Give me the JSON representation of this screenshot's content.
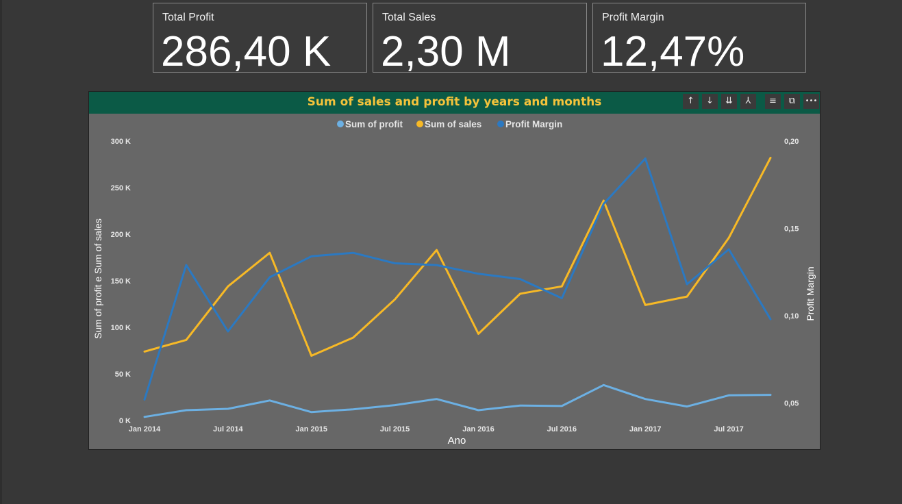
{
  "cards": [
    {
      "title": "Total Profit",
      "value": "286,40 K"
    },
    {
      "title": "Total Sales",
      "value": "2,30 M"
    },
    {
      "title": "Profit Margin",
      "value": "12,47%"
    }
  ],
  "toolbar_icons": [
    "arrow-up-icon",
    "arrow-down-icon",
    "double-arrow-down-icon",
    "expand-hierarchy-icon",
    "filter-icon",
    "focus-mode-icon",
    "more-options-icon"
  ],
  "toolbar_glyphs": {
    "up": "↑",
    "down": "↓",
    "down_all": "⇊",
    "expand": "⅄",
    "filter": "≡",
    "focus": "⧉",
    "more": "•••"
  },
  "chart_data": {
    "type": "line",
    "title": "Sum of sales and profit by years and months",
    "xlabel": "Ano",
    "ylabel": "Sum of profit e Sum of sales",
    "y2label": "Profit Margin",
    "x": [
      "Jan 2014",
      "Apr 2014",
      "Jul 2014",
      "Oct 2014",
      "Jan 2015",
      "Apr 2015",
      "Jul 2015",
      "Oct 2015",
      "Jan 2016",
      "Apr 2016",
      "Jul 2016",
      "Oct 2016",
      "Jan 2017",
      "Apr 2017",
      "Jul 2017",
      "Oct 2017"
    ],
    "x_tick_labels": [
      "Jan 2014",
      "Jul 2014",
      "Jan 2015",
      "Jul 2015",
      "Jan 2016",
      "Jul 2016",
      "Jan 2017",
      "Jul 2017"
    ],
    "ylim": [
      0,
      300000
    ],
    "y_tick_labels": [
      "0 K",
      "50 K",
      "100 K",
      "150 K",
      "200 K",
      "250 K",
      "300 K"
    ],
    "y2lim": [
      0.04,
      0.2
    ],
    "y2_ticks": [
      0.05,
      0.1,
      0.15,
      0.2
    ],
    "y2_tick_labels": [
      "0,05",
      "0,10",
      "0,15",
      "0,20"
    ],
    "legend_position": "top-center",
    "grid": false,
    "series": [
      {
        "name": "Sum of profit",
        "axis": "left",
        "color": "#6cb0e3",
        "values": [
          3800,
          11000,
          12500,
          21500,
          9000,
          12000,
          16500,
          23000,
          11000,
          16000,
          15500,
          38000,
          23000,
          15000,
          27000,
          27500
        ]
      },
      {
        "name": "Sum of sales",
        "axis": "left",
        "color": "#f7b926",
        "values": [
          74000,
          86500,
          144000,
          180000,
          69500,
          89000,
          130000,
          183000,
          93000,
          136000,
          144000,
          236000,
          124000,
          133000,
          196000,
          282000
        ]
      },
      {
        "name": "Profit Margin",
        "axis": "right",
        "color": "#2b79c2",
        "values": [
          0.052,
          0.129,
          0.091,
          0.122,
          0.134,
          0.136,
          0.13,
          0.129,
          0.124,
          0.121,
          0.11,
          0.164,
          0.19,
          0.118,
          0.138,
          0.098
        ]
      }
    ]
  }
}
